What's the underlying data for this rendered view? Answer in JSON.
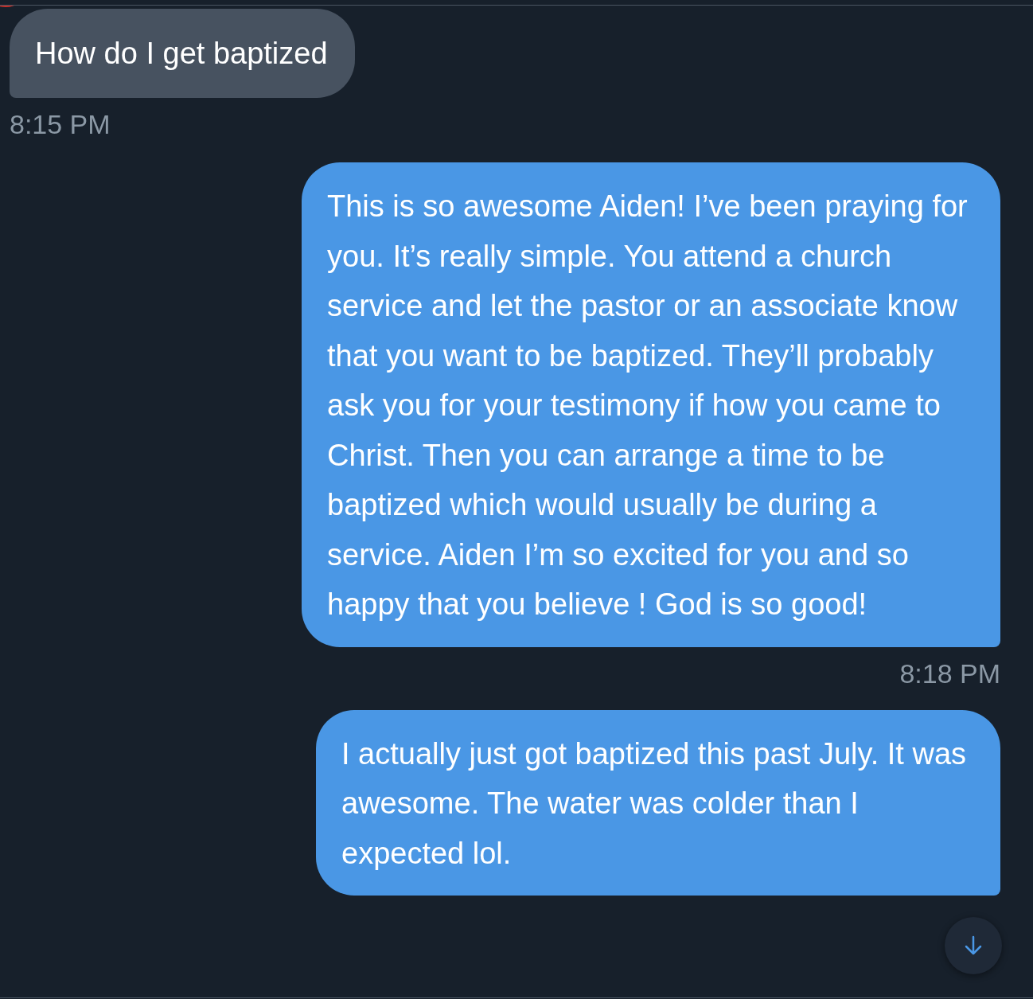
{
  "messages": [
    {
      "kind": "received",
      "text": "How do I get baptized",
      "time": "8:15 PM"
    },
    {
      "kind": "sent",
      "text": "This is so awesome Aiden! I’ve been praying for you. It’s really simple. You attend a church service and let the pastor or an associate know that you want to be baptized. They’ll probably ask you for your testimony if how you came to Christ. Then you can arrange a time to be baptized which would usually be during a service. Aiden I’m so excited for you and so happy that you believe ! God is so good!",
      "time": "8:18 PM"
    },
    {
      "kind": "sent",
      "text": "I actually just got baptized this past July. It was awesome. The water was colder than I expected lol."
    }
  ]
}
